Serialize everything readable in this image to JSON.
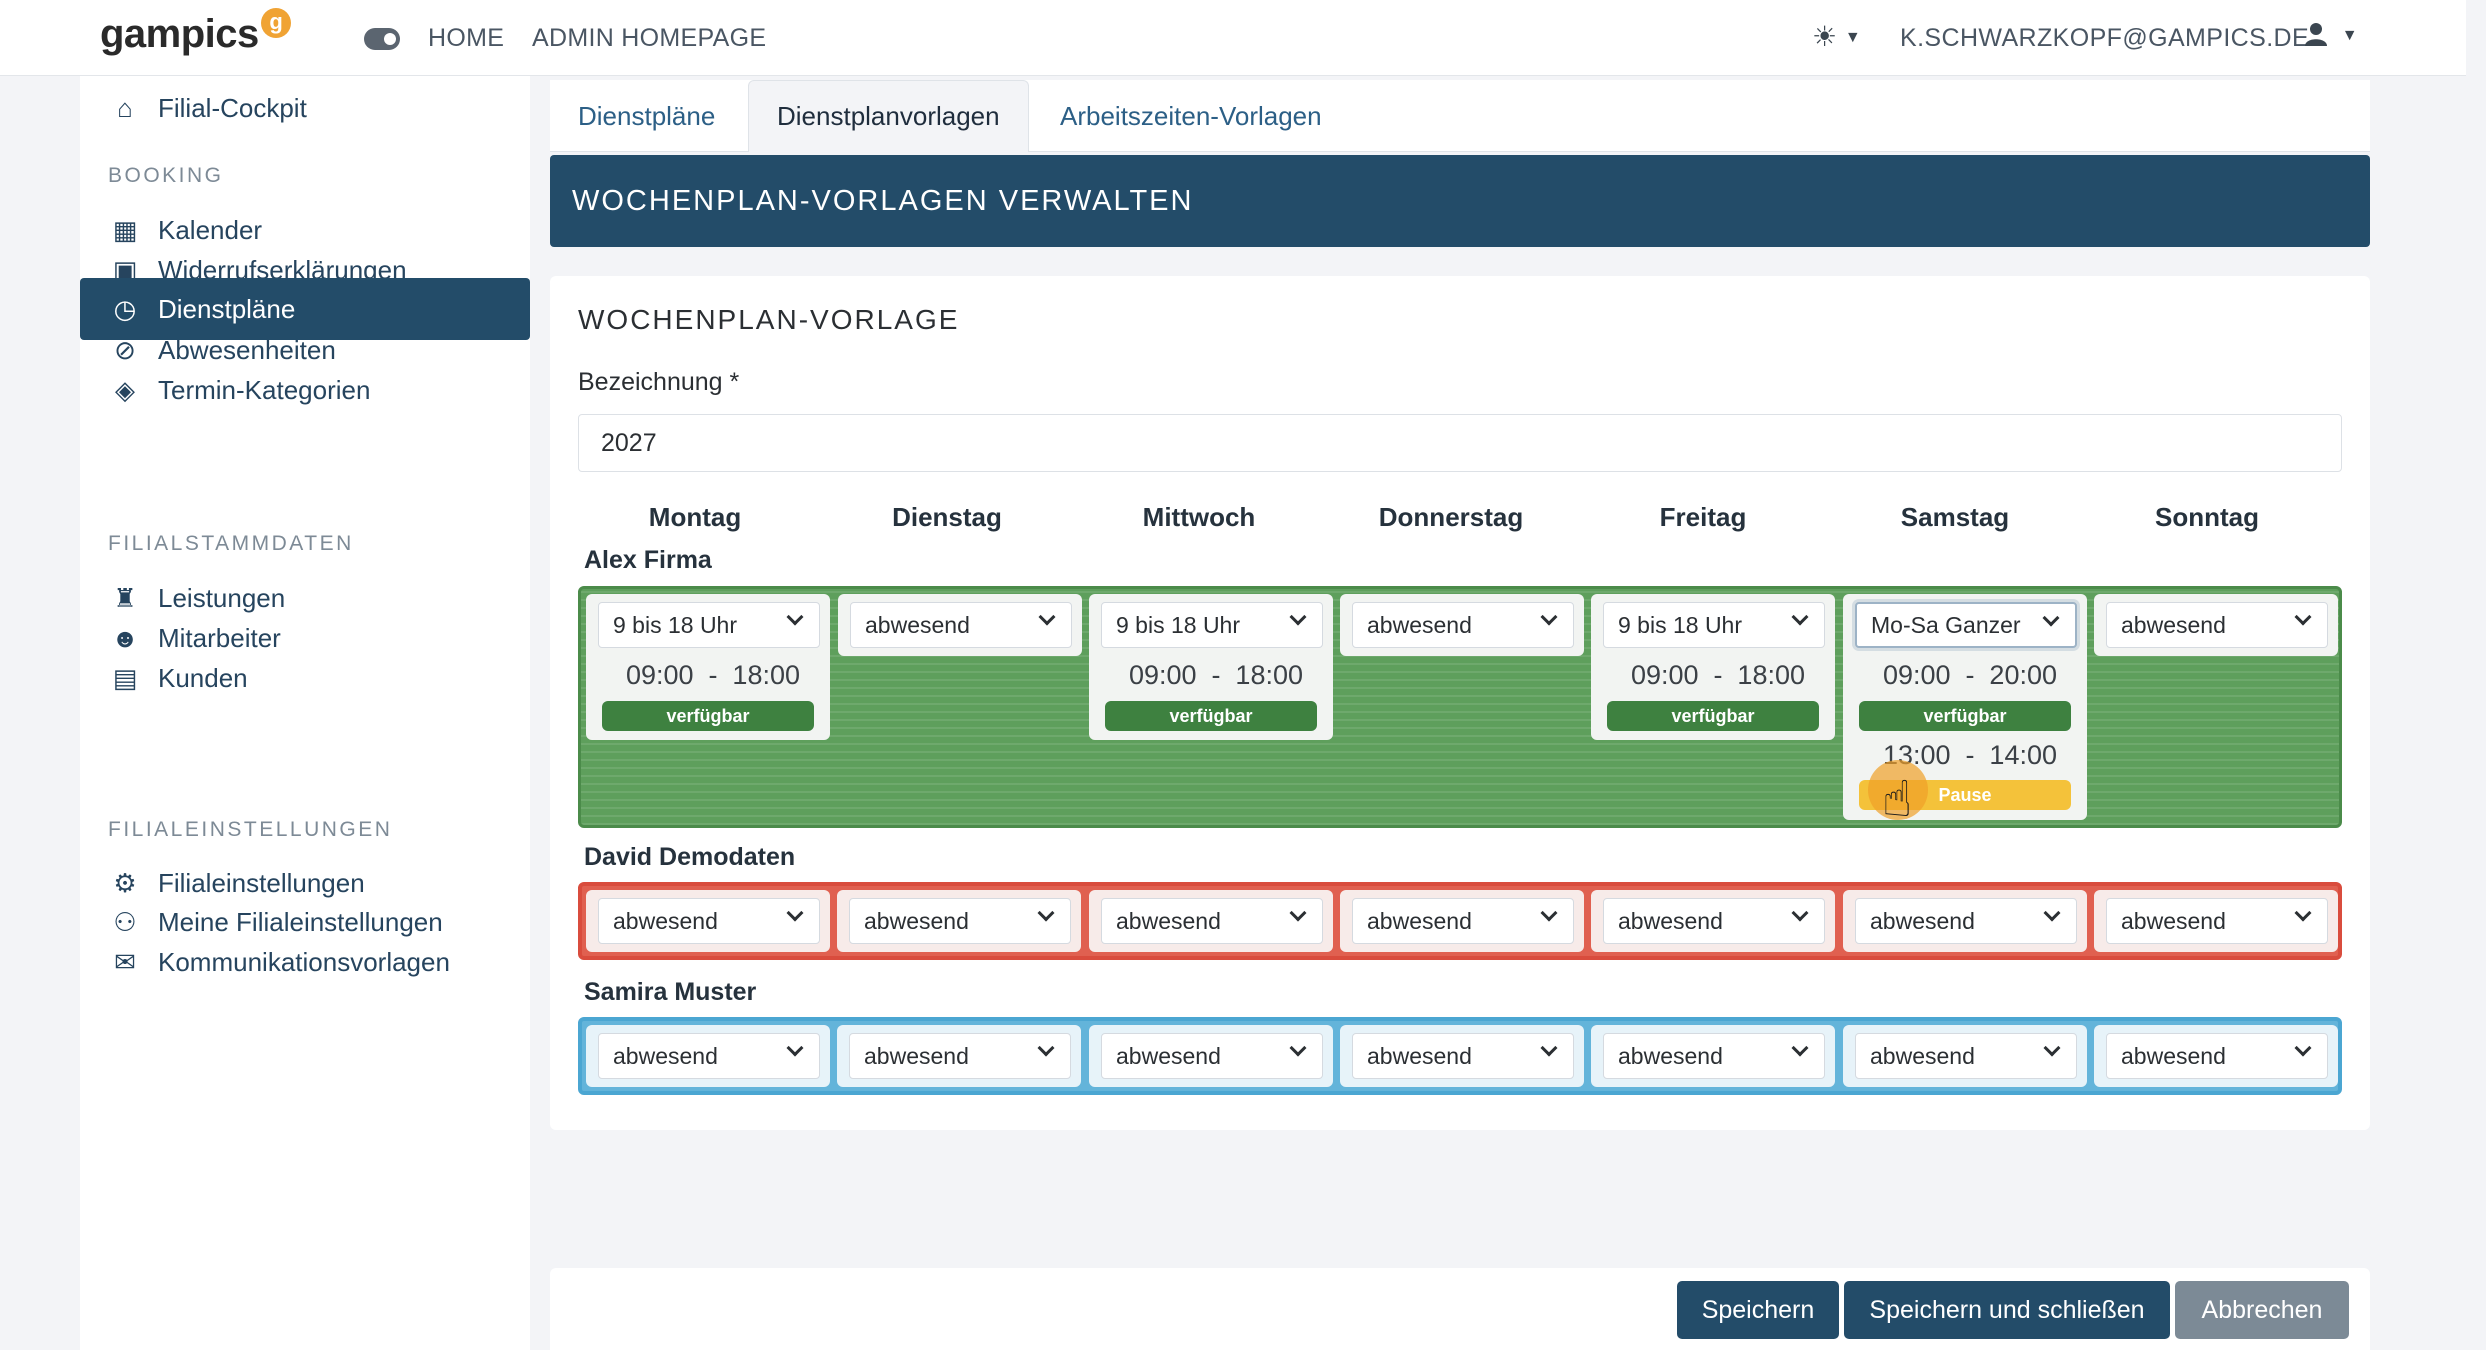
{
  "topbar": {
    "logo_text": "gampics",
    "logo_badge": "g",
    "nav": [
      "HOME",
      "ADMIN HOMEPAGE"
    ],
    "user_email": "K.SCHWARZKOPF@GAMPICS.DE"
  },
  "sidebar": {
    "items": {
      "cockpit": "Filial-Cockpit",
      "kalender": "Kalender",
      "widerruf": "Widerrufserklärungen",
      "dienstplaene": "Dienstpläne",
      "abwesenheiten": "Abwesenheiten",
      "termin": "Termin-Kategorien",
      "leistungen": "Leistungen",
      "mitarbeiter": "Mitarbeiter",
      "kunden": "Kunden",
      "filialeinstellungen": "Filialeinstellungen",
      "meine": "Meine Filialeinstellungen",
      "kommunikation": "Kommunikationsvorlagen"
    },
    "sections": {
      "booking": "BOOKING",
      "stammdaten": "FILIALSTAMMDATEN",
      "einstellungen": "FILIALEINSTELLUNGEN"
    }
  },
  "tabs": [
    "Dienstpläne",
    "Dienstplanvorlagen",
    "Arbeitszeiten-Vorlagen"
  ],
  "banner_title": "WOCHENPLAN-VORLAGEN VERWALTEN",
  "card": {
    "title": "WOCHENPLAN-VORLAGE",
    "field_label": "Bezeichnung *",
    "field_value": "2027"
  },
  "days": [
    "Montag",
    "Dienstag",
    "Mittwoch",
    "Donnerstag",
    "Freitag",
    "Samstag",
    "Sonntag"
  ],
  "employees": {
    "alex": {
      "name": "Alex Firma",
      "cells": [
        "9 bis 18 Uhr",
        "abwesend",
        "9 bis 18 Uhr",
        "abwesend",
        "9 bis 18 Uhr",
        "Mo-Sa Ganzer",
        "abwesend"
      ],
      "mon": {
        "start": "09:00",
        "end": "18:00",
        "status": "verfügbar"
      },
      "wed": {
        "start": "09:00",
        "end": "18:00",
        "status": "verfügbar"
      },
      "fri": {
        "start": "09:00",
        "end": "18:00",
        "status": "verfügbar"
      },
      "sat": {
        "start": "09:00",
        "end": "20:00",
        "status": "verfügbar",
        "pause_start": "13:00",
        "pause_end": "14:00",
        "pause_label": "Pause"
      }
    },
    "david": {
      "name": "David Demodaten",
      "cells": [
        "abwesend",
        "abwesend",
        "abwesend",
        "abwesend",
        "abwesend",
        "abwesend",
        "abwesend"
      ]
    },
    "samira": {
      "name": "Samira Muster",
      "cells": [
        "abwesend",
        "abwesend",
        "abwesend",
        "abwesend",
        "abwesend",
        "abwesend",
        "abwesend"
      ]
    }
  },
  "separator": "-",
  "buttons": {
    "save": "Speichern",
    "save_close": "Speichern und schließen",
    "cancel": "Abbrechen"
  },
  "colors": {
    "primary": "#234c69",
    "available_row": "#5e9f5c",
    "absent_row_red": "#e06050",
    "absent_row_blue": "#63b4da",
    "pause": "#f4c23a"
  }
}
